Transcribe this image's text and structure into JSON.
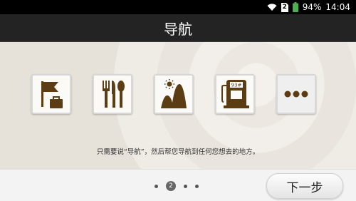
{
  "status_bar": {
    "battery": "94%",
    "time": "14:04",
    "sim_label": "2"
  },
  "title": "导航",
  "icons": [
    {
      "name": "flag-suitcase-icon"
    },
    {
      "name": "fork-knife-spoon-icon"
    },
    {
      "name": "sun-mountain-icon"
    },
    {
      "name": "gas-station-icon",
      "label": "93#"
    },
    {
      "name": "more-icon"
    }
  ],
  "description": "只需要说“导航”，然后帮您导航到任何您想去的地方。",
  "pagination": {
    "current": "2",
    "total": 4
  },
  "next_button_label": "下一步",
  "colors": {
    "icon_brown": "#5c3d13",
    "title_bar": "#232323"
  }
}
